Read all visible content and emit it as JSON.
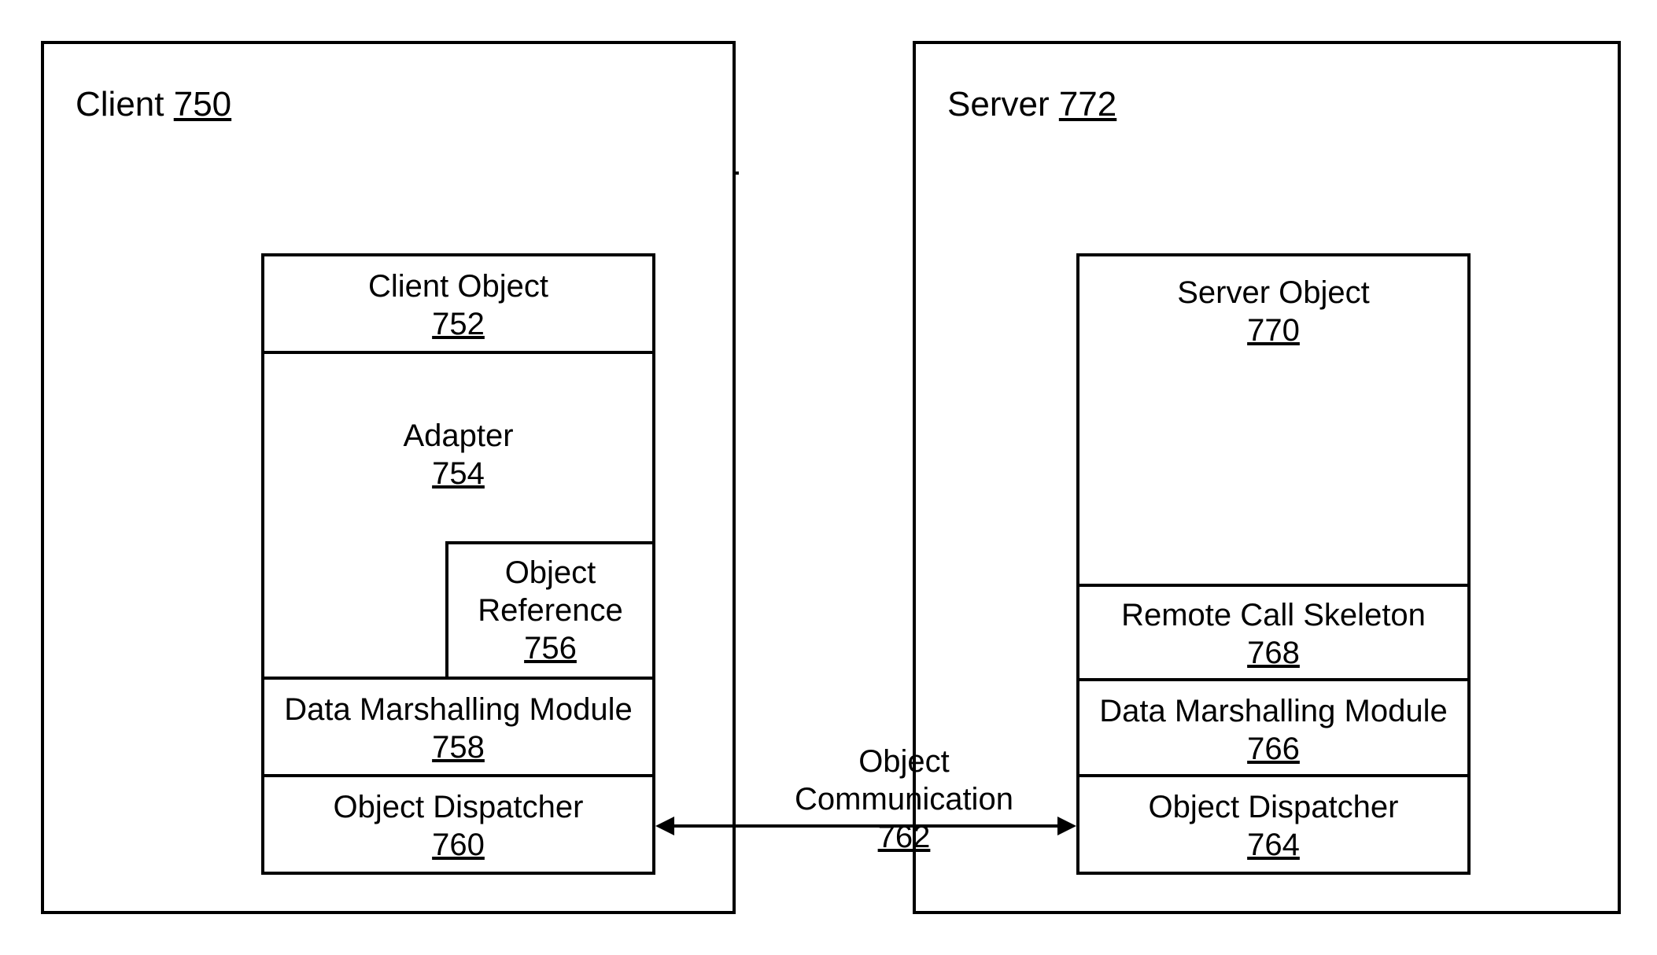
{
  "client": {
    "title_word": "Client",
    "title_num": "750",
    "client_object": {
      "label": "Client Object",
      "num": "752"
    },
    "adapter": {
      "label": "Adapter",
      "num": "754"
    },
    "object_reference": {
      "label_l1": "Object",
      "label_l2": "Reference",
      "num": "756"
    },
    "marshalling": {
      "label": "Data Marshalling Module",
      "num": "758"
    },
    "dispatcher": {
      "label": "Object Dispatcher",
      "num": "760"
    }
  },
  "server": {
    "title_word": "Server",
    "title_num": "772",
    "server_object": {
      "label": "Server Object",
      "num": "770"
    },
    "skeleton": {
      "label": "Remote Call Skeleton",
      "num": "768"
    },
    "marshalling": {
      "label": "Data Marshalling Module",
      "num": "766"
    },
    "dispatcher": {
      "label": "Object Dispatcher",
      "num": "764"
    }
  },
  "comm": {
    "label_l1": "Object",
    "label_l2": "Communication",
    "num": "762"
  }
}
